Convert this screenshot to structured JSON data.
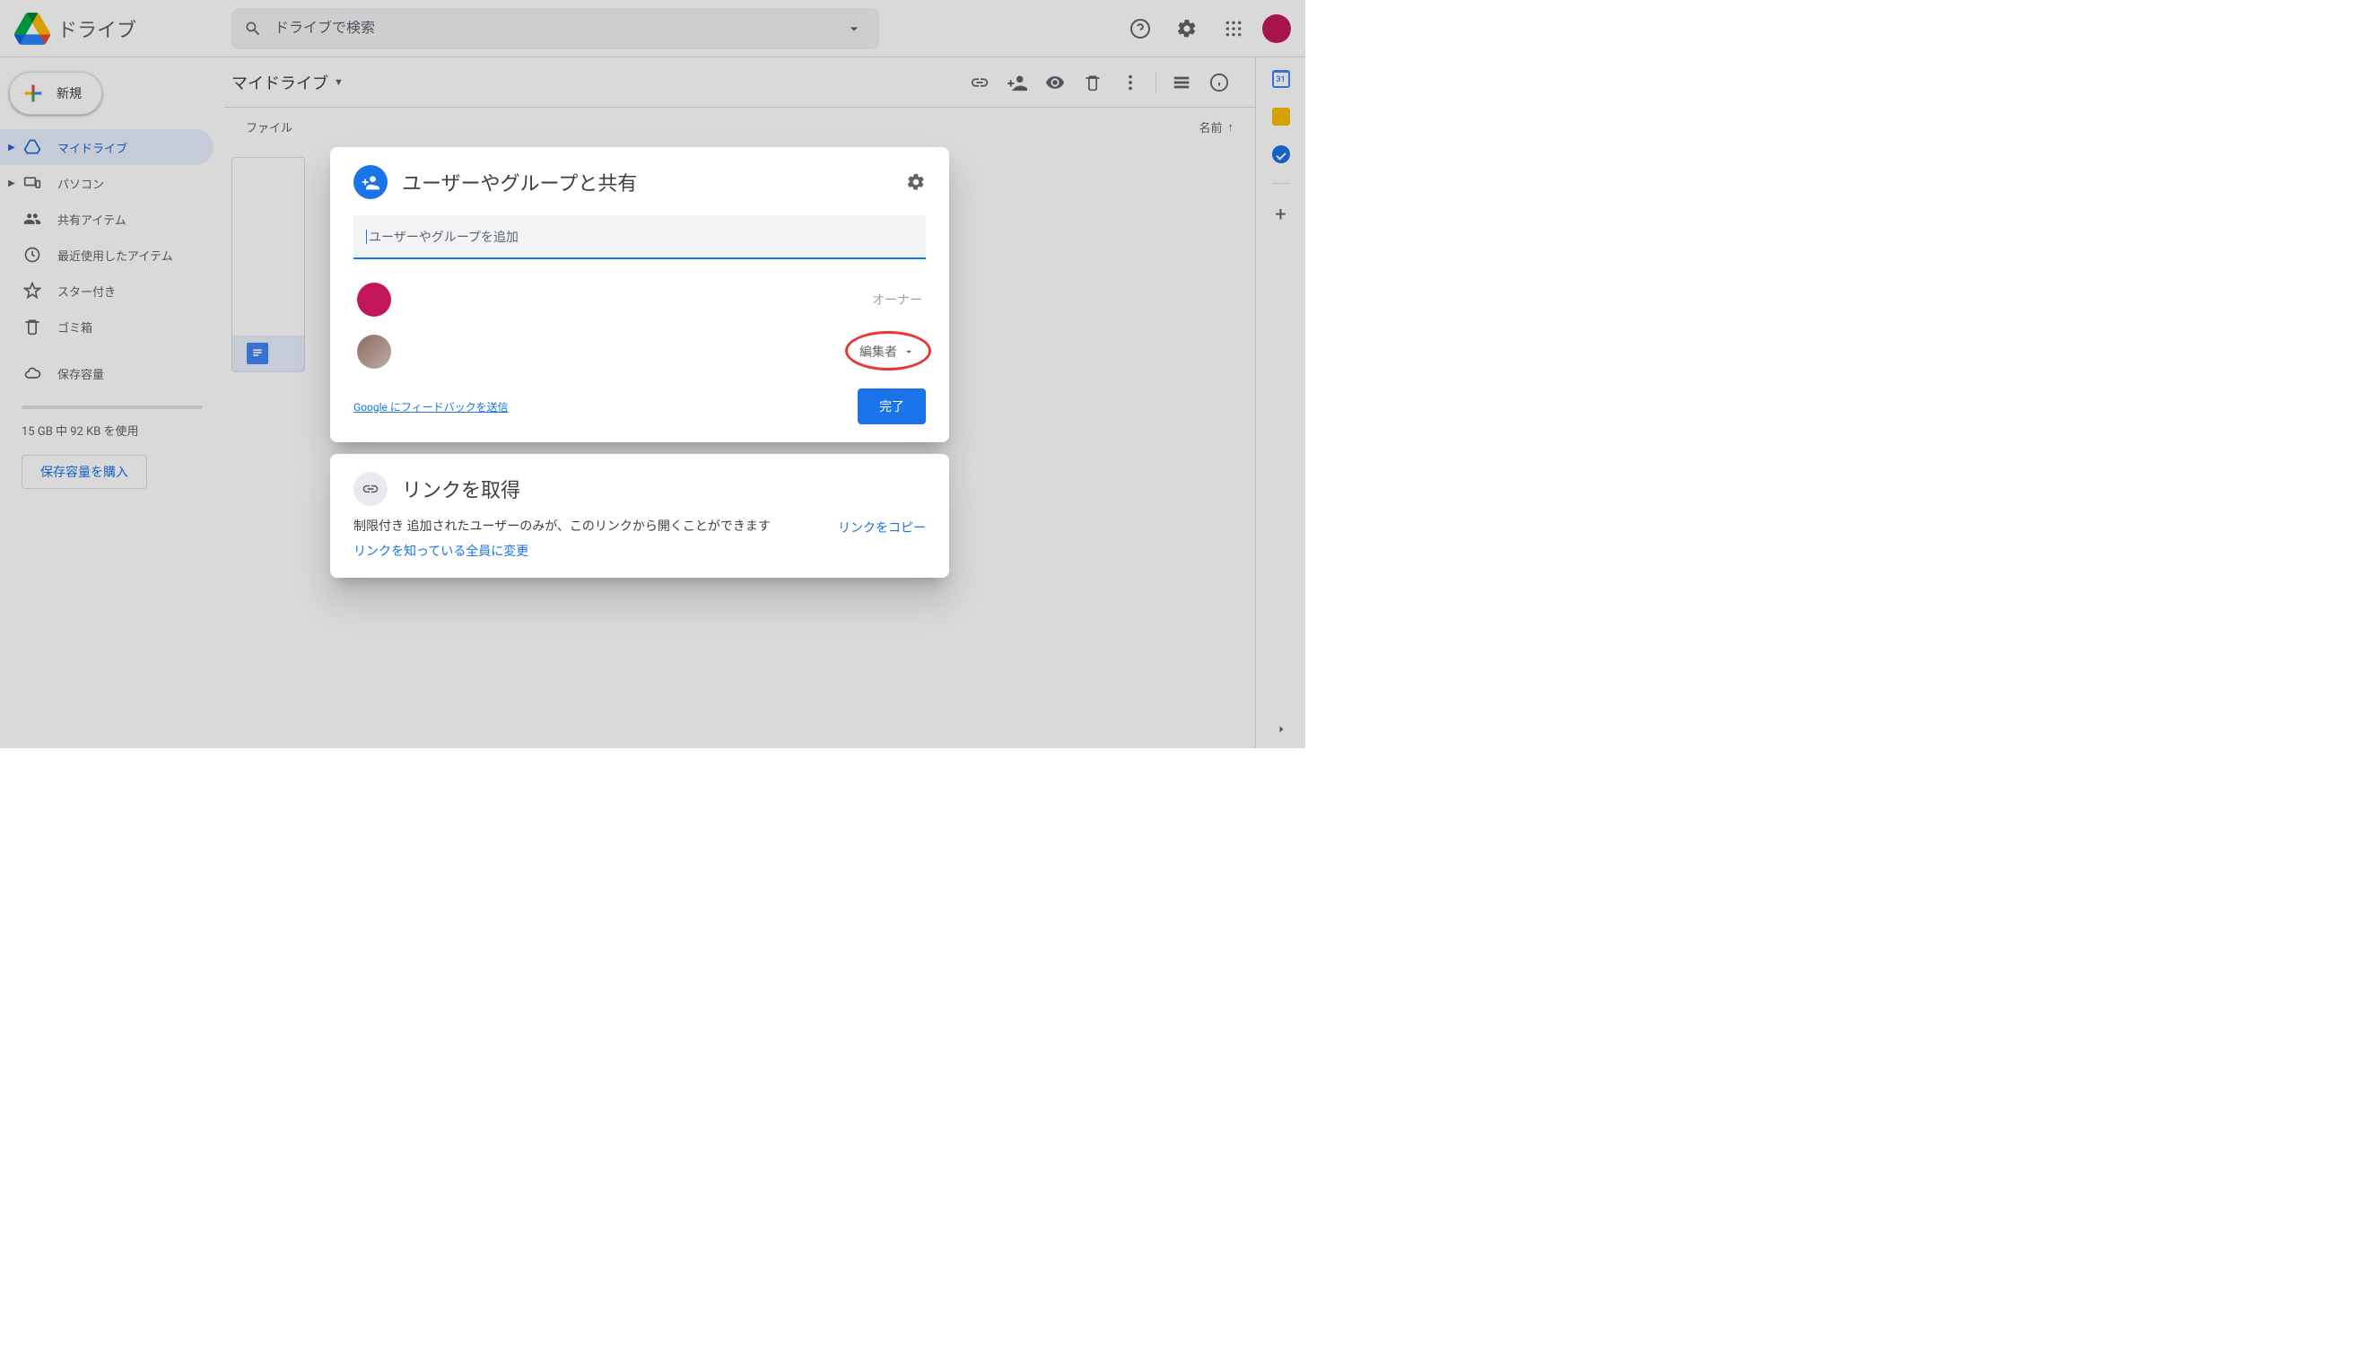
{
  "app": {
    "name": "ドライブ"
  },
  "search": {
    "placeholder": "ドライブで検索"
  },
  "newButton": {
    "label": "新規"
  },
  "nav": {
    "mydrive": "マイドライブ",
    "computers": "パソコン",
    "shared": "共有アイテム",
    "recent": "最近使用したアイテム",
    "starred": "スター付き",
    "trash": "ゴミ箱",
    "storage": "保存容量"
  },
  "storage": {
    "usage": "15 GB 中 92 KB を使用",
    "buy": "保存容量を購入"
  },
  "breadcrumb": {
    "mydrive": "マイドライブ"
  },
  "columns": {
    "file": "ファイル",
    "name": "名前",
    "sortArrow": "↑"
  },
  "share": {
    "title": "ユーザーやグループと共有",
    "placeholder": "ユーザーやグループを追加",
    "ownerRole": "オーナー",
    "editorRole": "編集者",
    "feedback": "Google にフィードバックを送信",
    "done": "完了"
  },
  "link": {
    "title": "リンクを取得",
    "restrictedLabel": "制限付き",
    "restrictedDesc": " 追加されたユーザーのみが、このリンクから開くことができます",
    "change": "リンクを知っている全員に変更",
    "copy": "リンクをコピー"
  }
}
